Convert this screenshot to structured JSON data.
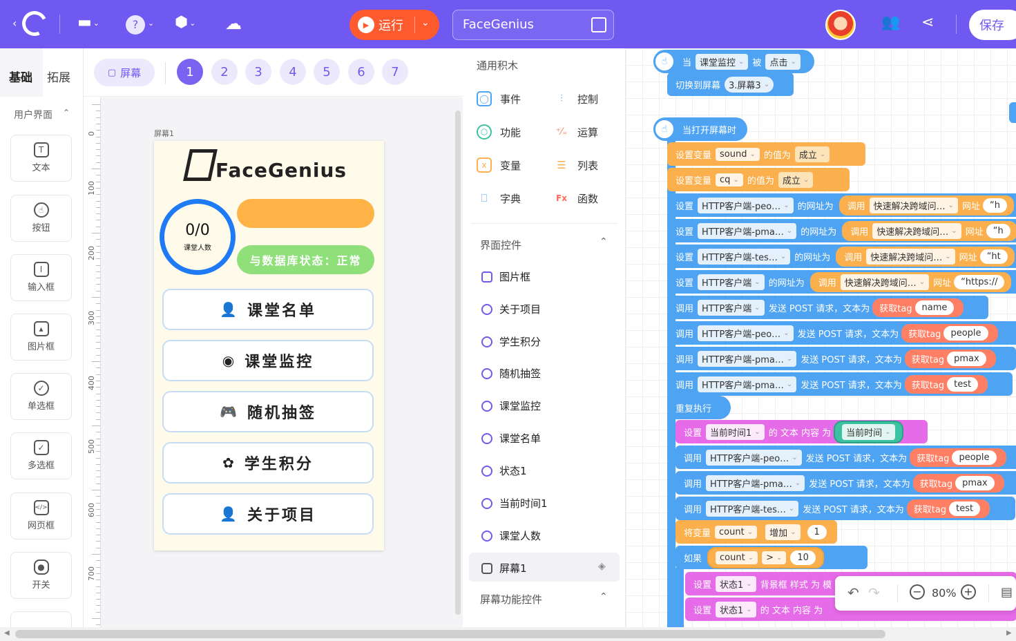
{
  "topbar": {
    "run_label": "运行",
    "project_name": "FaceGenius",
    "save_label": "保存"
  },
  "left_tabs": {
    "basic": "基础",
    "extend": "拓展"
  },
  "ui_section": "用户界面",
  "components": [
    "文本",
    "按钮",
    "输入框",
    "图片框",
    "单选框",
    "多选框",
    "网页框",
    "开关"
  ],
  "screens": {
    "label": "屏幕",
    "pages": [
      "1",
      "2",
      "3",
      "4",
      "5",
      "6",
      "7"
    ],
    "active": "1"
  },
  "ruler_labels": [
    "0",
    "100",
    "200",
    "300",
    "400",
    "500",
    "600",
    "700"
  ],
  "canvas": {
    "screen_label": "屏幕1",
    "logo_text": "FaceGenius",
    "count": "0/0",
    "count_label": "课堂人数",
    "db_status": "与数据库状态：正常",
    "buttons": [
      {
        "icon": "👤",
        "label": "课堂名单"
      },
      {
        "icon": "◉",
        "label": "课堂监控"
      },
      {
        "icon": "🎮",
        "label": "随机抽签"
      },
      {
        "icon": "✿",
        "label": "学生积分"
      },
      {
        "icon": "👤",
        "label": "关于项目"
      }
    ]
  },
  "palette": {
    "general_title": "通用积木",
    "categories": [
      {
        "label": "事件",
        "color": "#4ea4f2"
      },
      {
        "label": "控制",
        "color": "#4ea4f2"
      },
      {
        "label": "功能",
        "color": "#3cc2a0"
      },
      {
        "label": "运算",
        "color": "#ff7f64"
      },
      {
        "label": "变量",
        "color": "#fbb04d"
      },
      {
        "label": "列表",
        "color": "#fbb04d"
      },
      {
        "label": "字典",
        "color": "#4ea4f2"
      },
      {
        "label": "函数",
        "color": "#ff6b5a"
      }
    ],
    "ui_controls_title": "界面控件",
    "ui_controls": [
      "图片框",
      "关于项目",
      "学生积分",
      "随机抽签",
      "课堂监控",
      "课堂名单",
      "状态1",
      "当前时间1",
      "课堂人数",
      "屏幕1"
    ],
    "screen_func_title": "屏幕功能控件"
  },
  "blocks": {
    "b1": {
      "when": "当",
      "target": "课堂监控",
      "by": "被",
      "event": "点击"
    },
    "b2": {
      "action": "切换到屏幕",
      "screen": "3.屏幕3"
    },
    "b3": {
      "label": "当打开屏幕时"
    },
    "b4": {
      "set": "设置变量",
      "var": "sound",
      "value_of": "的值为",
      "val": "成立"
    },
    "b5": {
      "set": "设置变量",
      "var": "cq",
      "value_of": "的值为",
      "val": "成立"
    },
    "http_set": [
      {
        "set": "设置",
        "obj": "HTTP客户端-peo…",
        "prop": "的网址为",
        "call": "调用",
        "fn": "快速解决跨域问…",
        "url_label": "网址",
        "url": "“h"
      },
      {
        "set": "设置",
        "obj": "HTTP客户端-pma…",
        "prop": "的网址为",
        "call": "调用",
        "fn": "快速解决跨域问…",
        "url_label": "网址",
        "url": "“h"
      },
      {
        "set": "设置",
        "obj": "HTTP客户端-tes…",
        "prop": "的网址为",
        "call": "调用",
        "fn": "快速解决跨域问…",
        "url_label": "网址",
        "url": "“ht"
      },
      {
        "set": "设置",
        "obj": "HTTP客户端",
        "prop": "的网址为",
        "call": "调用",
        "fn": "快速解决跨域问…",
        "url_label": "网址",
        "url": "“https://"
      }
    ],
    "post": [
      {
        "call": "调用",
        "obj": "HTTP客户端",
        "act": "发送 POST 请求，文本为",
        "tag": "获取tag",
        "val": "name"
      },
      {
        "call": "调用",
        "obj": "HTTP客户端-peo…",
        "act": "发送 POST 请求，文本为",
        "tag": "获取tag",
        "val": "people"
      },
      {
        "call": "调用",
        "obj": "HTTP客户端-pma…",
        "act": "发送 POST 请求，文本为",
        "tag": "获取tag",
        "val": "pmax"
      },
      {
        "call": "调用",
        "obj": "HTTP客户端-pma…",
        "act": "发送 POST 请求，文本为",
        "tag": "获取tag",
        "val": "test"
      }
    ],
    "repeat": "重复执行",
    "set_time": {
      "set": "设置",
      "obj": "当前时间1",
      "prop": "的 文本 内容 为",
      "val": "当前时间"
    },
    "post2": [
      {
        "call": "调用",
        "obj": "HTTP客户端-peo…",
        "act": "发送 POST 请求，文本为",
        "tag": "获取tag",
        "val": "people"
      },
      {
        "call": "调用",
        "obj": "HTTP客户端-pma…",
        "act": "发送 POST 请求，文本为",
        "tag": "获取tag",
        "val": "pmax"
      },
      {
        "call": "调用",
        "obj": "HTTP客户端-tes…",
        "act": "发送 POST 请求，文本为",
        "tag": "获取tag",
        "val": "test"
      }
    ],
    "incr": {
      "label": "将变量",
      "var": "count",
      "op": "增加",
      "val": "1"
    },
    "if": {
      "label": "如果",
      "var": "count",
      "op": ">",
      "val": "10"
    },
    "set_bg": {
      "set": "设置",
      "obj": "状态1",
      "prop": "背景框 样式 为 模"
    },
    "set_text": {
      "set": "设置",
      "obj": "状态1",
      "prop": "的 文本 内容 为"
    }
  },
  "zoom": {
    "level": "80%"
  }
}
